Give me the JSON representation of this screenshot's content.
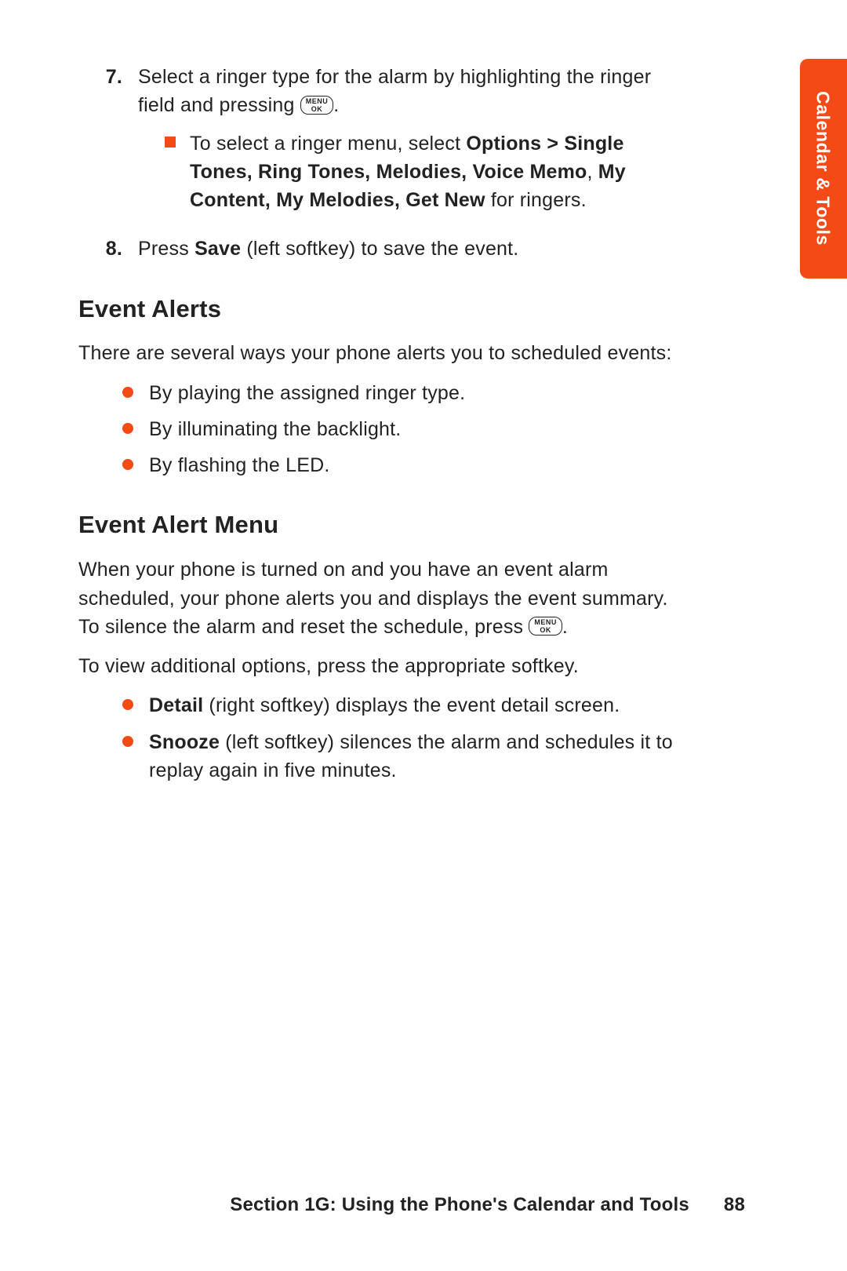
{
  "sidetab": "Calendar & Tools",
  "key_top": "MENU",
  "key_bottom": "OK",
  "steps": {
    "s7": {
      "num": "7.",
      "text_a": "Select a ringer type for the alarm by highlighting the ringer field and pressing ",
      "text_b": ".",
      "sub_a": "To select a ringer menu, select ",
      "sub_bold": "Options > Single Tones, Ring Tones, Melodies, Voice Memo",
      "sub_mid": ", ",
      "sub_bold2": "My Content, My Melodies, Get New",
      "sub_c": " for ringers."
    },
    "s8": {
      "num": "8.",
      "a": "Press ",
      "bold": "Save",
      "b": " (left softkey) to save the event."
    }
  },
  "h_event_alerts": "Event Alerts",
  "alerts_intro": "There are several ways your phone alerts you to scheduled events:",
  "alerts_items": [
    "By playing the assigned ringer type.",
    "By illuminating the backlight.",
    "By flashing the LED."
  ],
  "h_event_menu": "Event Alert Menu",
  "menu_para_a": "When your phone is turned on and you have an event alarm scheduled, your phone alerts you and displays the event summary. To silence the alarm and reset the schedule, press ",
  "menu_para_b": ".",
  "menu_para2": "To view additional options, press the appropriate softkey.",
  "menu_items": [
    {
      "bold": "Detail",
      "rest": " (right softkey) displays the event detail screen."
    },
    {
      "bold": "Snooze",
      "rest": " (left softkey) silences the alarm and schedules it to replay again in five minutes."
    }
  ],
  "footer_section": "Section 1G: Using the Phone's Calendar and Tools",
  "footer_page": "88"
}
